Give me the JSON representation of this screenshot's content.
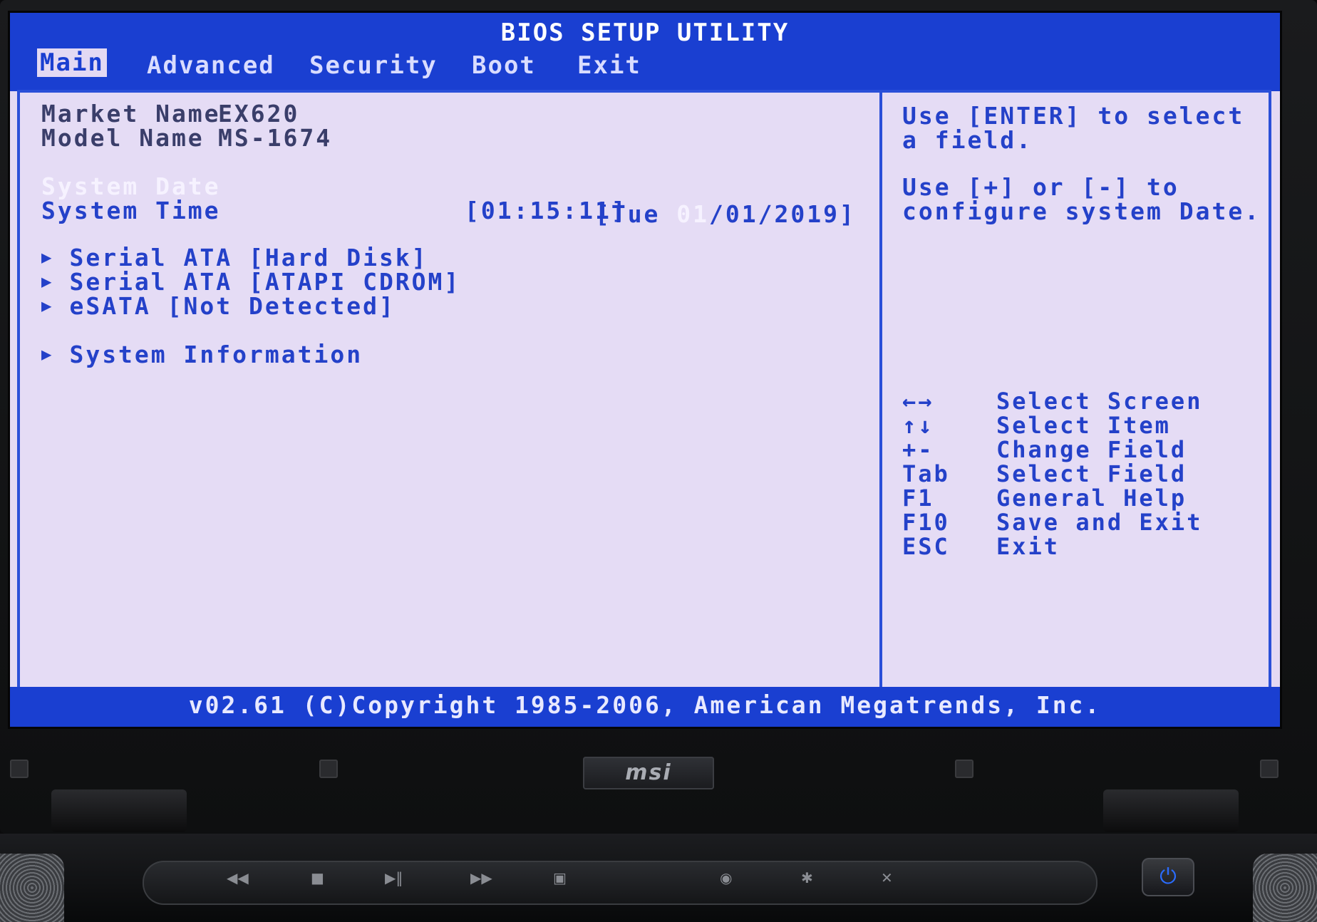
{
  "app_title": "BIOS SETUP UTILITY",
  "menu": [
    {
      "label": "Main",
      "active": true
    },
    {
      "label": "Advanced",
      "active": false
    },
    {
      "label": "Security",
      "active": false
    },
    {
      "label": "Boot",
      "active": false
    },
    {
      "label": "Exit",
      "active": false
    }
  ],
  "info": {
    "market_name_label": "Market Name",
    "market_name_value": "EX620",
    "model_name_label": "Model Name",
    "model_name_value": "MS-1674"
  },
  "settings": {
    "system_date_label": "System Date",
    "system_date_open": "[Tue ",
    "system_date_highlight": "01",
    "system_date_rest": "/01/2019]",
    "system_time_label": "System Time",
    "system_time_value": "[01:15:11]"
  },
  "submenus": [
    "Serial ATA [Hard Disk]",
    "Serial ATA [ATAPI CDROM]",
    "eSATA [Not Detected]",
    "System Information"
  ],
  "help": {
    "line1": "Use [ENTER] to select",
    "line2": "a field.",
    "line3": "Use [+] or [-] to",
    "line4": "configure system Date."
  },
  "keys": [
    {
      "key": "←→",
      "action": "Select Screen"
    },
    {
      "key": "↑↓",
      "action": "Select Item"
    },
    {
      "key": "+-",
      "action": "Change Field"
    },
    {
      "key": "Tab",
      "action": "Select Field"
    },
    {
      "key": "F1",
      "action": "General Help"
    },
    {
      "key": "F10",
      "action": "Save and Exit"
    },
    {
      "key": "ESC",
      "action": "Exit"
    }
  ],
  "footer": "v02.61 (C)Copyright 1985-2006, American Megatrends, Inc.",
  "brand_logo": "msi",
  "colors": {
    "bios_blue": "#1a3fd1",
    "bios_background": "#e3d9f3",
    "text_blue": "#2441c9",
    "highlight_white": "#f6f2ff",
    "power_led": "#2a6cff"
  }
}
